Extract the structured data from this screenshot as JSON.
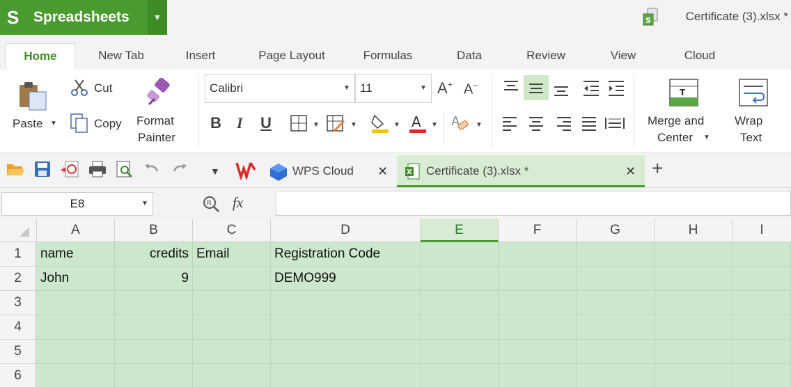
{
  "app": {
    "logo": "S",
    "name": "Spreadsheets",
    "document_title": "Certificate (3).xlsx *"
  },
  "menu": [
    "Home",
    "New Tab",
    "Insert",
    "Page Layout",
    "Formulas",
    "Data",
    "Review",
    "View",
    "Cloud"
  ],
  "ribbon": {
    "paste": "Paste",
    "cut": "Cut",
    "copy": "Copy",
    "format_painter_1": "Format",
    "format_painter_2": "Painter",
    "font_name": "Calibri",
    "font_size": "11",
    "bold": "B",
    "italic": "I",
    "underline": "U",
    "merge_1": "Merge and",
    "merge_2": "Center",
    "wrap_1": "Wrap",
    "wrap_2": "Text"
  },
  "doc_tabs": [
    {
      "label": "WPS Cloud"
    },
    {
      "label": "Certificate (3).xlsx *"
    }
  ],
  "formula_bar": {
    "cell_ref": "E8",
    "fx": "fx",
    "value": ""
  },
  "sheet": {
    "columns": [
      "A",
      "B",
      "C",
      "D",
      "E",
      "F",
      "G",
      "H",
      "I"
    ],
    "selected_column": "E",
    "rows": [
      "1",
      "2",
      "3",
      "4",
      "5",
      "6"
    ],
    "cells": {
      "A1": "name",
      "B1": "credits",
      "C1": "Email",
      "D1": "Registration Code",
      "A2": "John",
      "B2": "9",
      "D2": "DEMO999"
    }
  },
  "colors": {
    "brand": "#4a9b2f",
    "selection": "#cde7cd"
  }
}
